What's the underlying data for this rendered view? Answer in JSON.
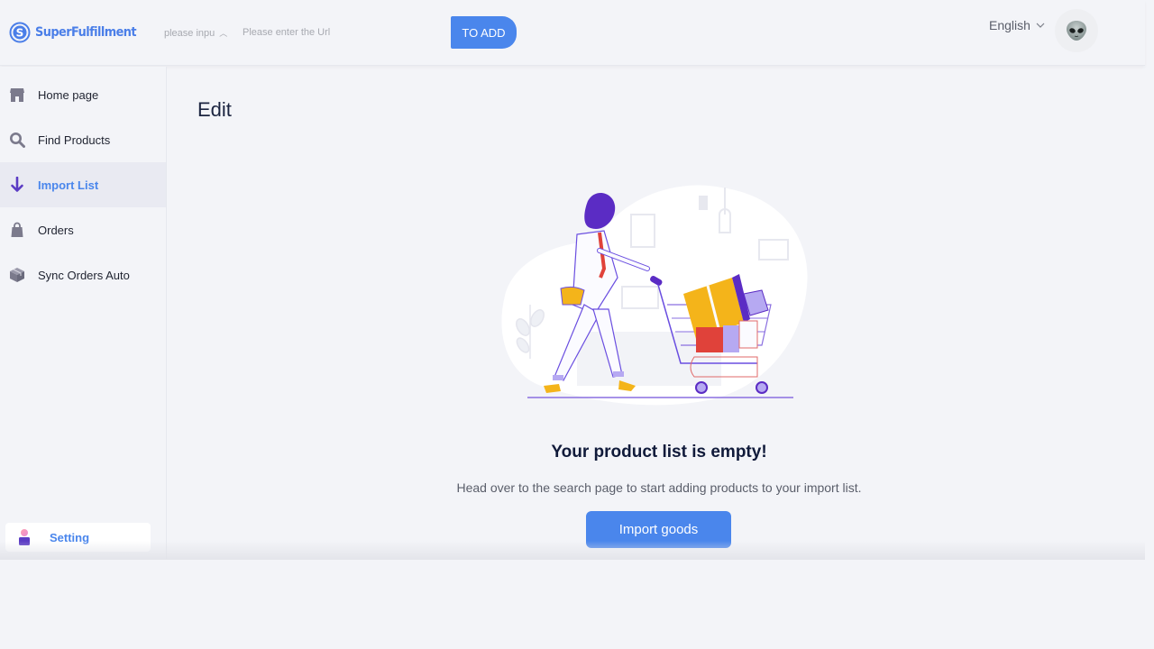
{
  "header": {
    "brand": "SuperFulfillment",
    "type_select": "please inpu",
    "url_placeholder": "Please enter the Url",
    "url_value": "",
    "add_button": "TO ADD",
    "language": "English",
    "avatar_icon": "alien-icon"
  },
  "sidebar": {
    "items": [
      {
        "label": "Home page",
        "icon": "store-icon",
        "active": false
      },
      {
        "label": "Find Products",
        "icon": "search-icon",
        "active": false
      },
      {
        "label": "Import List",
        "icon": "arrow-down-icon",
        "active": true
      },
      {
        "label": "Orders",
        "icon": "bag-icon",
        "active": false
      },
      {
        "label": "Sync Orders Auto",
        "icon": "box-icon",
        "active": false
      }
    ],
    "setting_label": "Setting"
  },
  "main": {
    "title": "Edit",
    "empty_title": "Your product list is empty!",
    "empty_description": "Head over to the search page to start adding products to your import list.",
    "import_button": "Import goods"
  },
  "colors": {
    "accent": "#4a86ec",
    "active_icon": "#5b3cc4",
    "background": "#f3f4f8"
  }
}
